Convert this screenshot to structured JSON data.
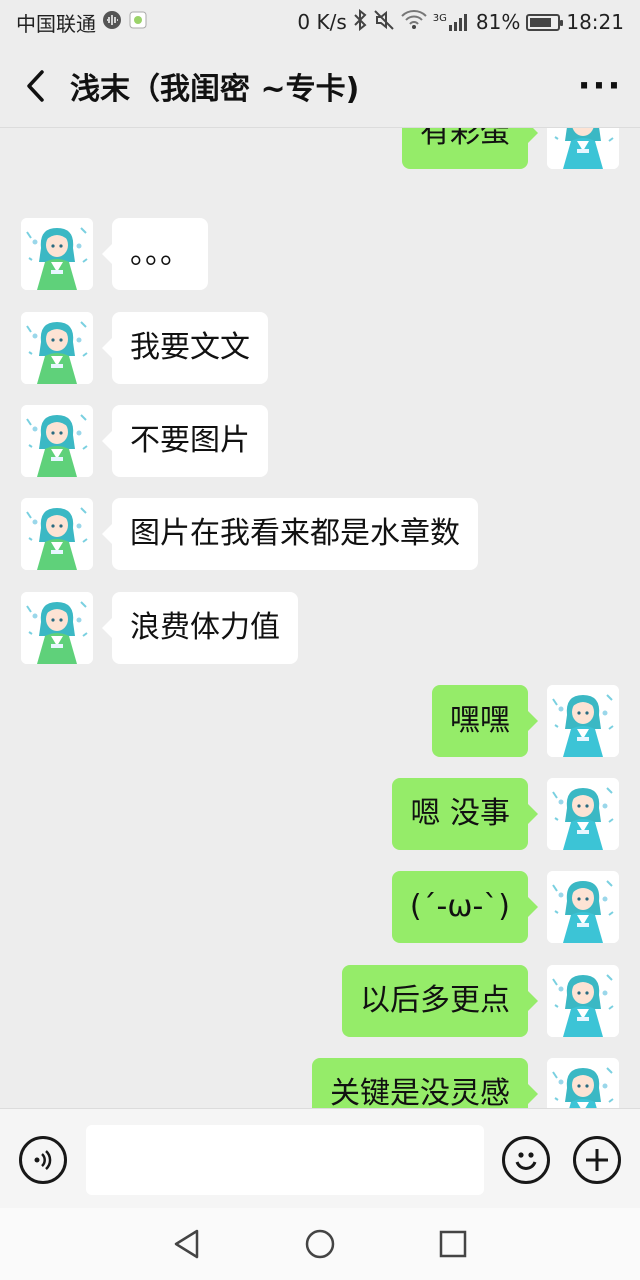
{
  "status_bar": {
    "carrier": "中国联通",
    "net_speed": "0 K/s",
    "network_type": "3G",
    "battery": "81%",
    "battery_level": 0.81,
    "time": "18:21",
    "icons": [
      "soundwave-icon",
      "wechat-notify-icon",
      "bluetooth-icon",
      "mute-icon",
      "wifi-icon",
      "signal-icon",
      "battery-icon"
    ]
  },
  "header": {
    "title": "浅末（我闺密 ~专卡)",
    "back_icon": "chevron-left-icon",
    "more_icon": "more-dots-icon"
  },
  "messages": [
    {
      "side": "out",
      "text": "有彩蛋",
      "partial": true
    },
    {
      "side": "in",
      "text": "。。。"
    },
    {
      "side": "in",
      "text": "我要文文"
    },
    {
      "side": "in",
      "text": "不要图片"
    },
    {
      "side": "in",
      "text": "图片在我看来都是水章数"
    },
    {
      "side": "in",
      "text": "浪费体力值"
    },
    {
      "side": "out",
      "text": "嘿嘿"
    },
    {
      "side": "out",
      "text": "嗯 没事"
    },
    {
      "side": "out",
      "text": "(´-ω-`)"
    },
    {
      "side": "out",
      "text": "以后多更点"
    },
    {
      "side": "out",
      "text": "关键是没灵感"
    }
  ],
  "input_bar": {
    "voice_icon": "voice-icon",
    "text_value": "",
    "emoji_icon": "emoji-icon",
    "plus_icon": "plus-icon"
  },
  "nav_bar": {
    "icons": [
      "nav-back-icon",
      "nav-home-icon",
      "nav-recent-icon"
    ]
  },
  "colors": {
    "background": "#ededed",
    "outgoing_bubble": "#95ec69",
    "incoming_bubble": "#ffffff",
    "avatar_in_dress": "#5fd17a",
    "avatar_out_dress": "#3cc4d6"
  }
}
